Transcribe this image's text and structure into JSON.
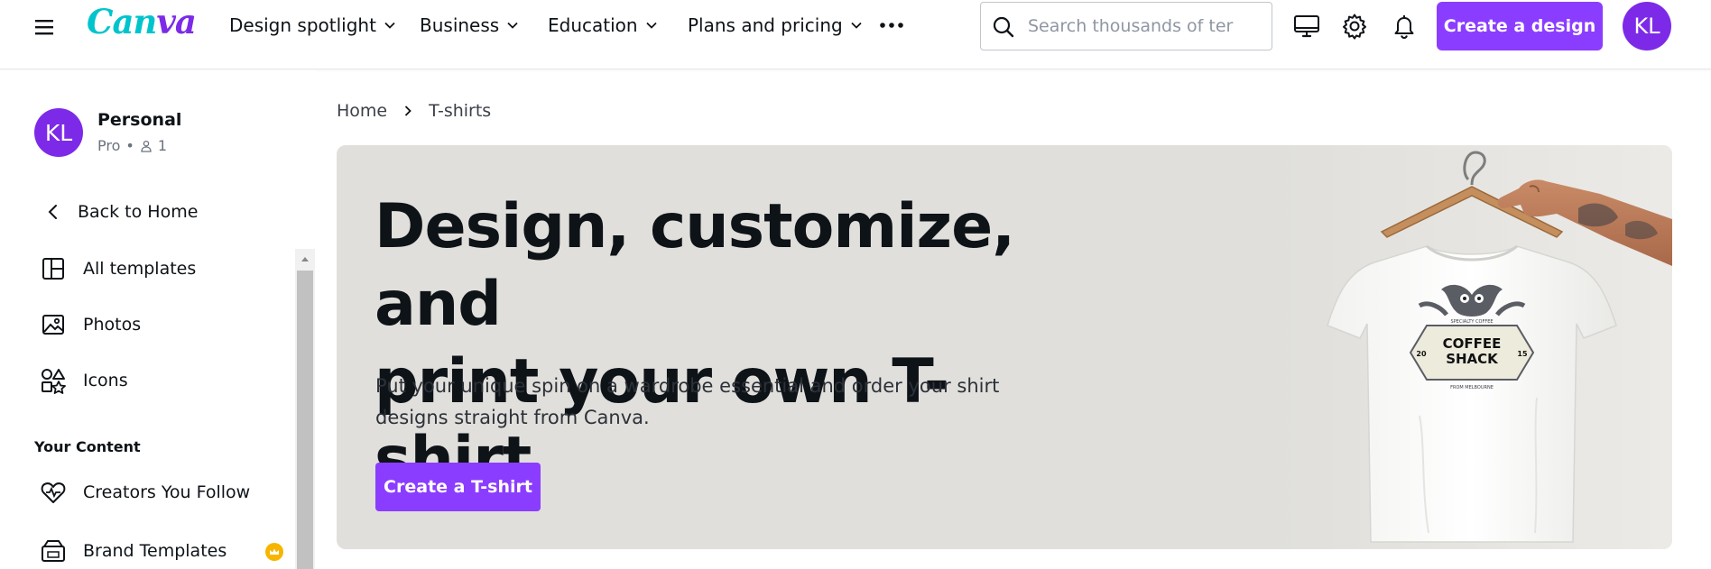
{
  "brand": {
    "logo_text_a": "Can",
    "logo_text_b": "va"
  },
  "nav": {
    "items": [
      {
        "label": "Design spotlight"
      },
      {
        "label": "Business"
      },
      {
        "label": "Education"
      },
      {
        "label": "Plans and pricing"
      }
    ],
    "more_icon": "more-dots-icon"
  },
  "search": {
    "placeholder": "Search thousands of ter",
    "value": ""
  },
  "toolbar": {
    "create_label": "Create a design",
    "avatar_initials": "KL",
    "icons": [
      "desktop-icon",
      "settings-gear-icon",
      "notification-bell-icon"
    ]
  },
  "sidebar": {
    "account_name": "Personal",
    "account_plan": "Pro",
    "account_separator": "•",
    "member_count": "1",
    "avatar_initials": "KL",
    "items": [
      {
        "label": "Back to Home",
        "icon": "chevron-left-icon"
      },
      {
        "label": "All templates",
        "icon": "templates-icon"
      },
      {
        "label": "Photos",
        "icon": "photo-icon"
      },
      {
        "label": "Icons",
        "icon": "shapes-icon"
      }
    ],
    "section_label": "Your Content",
    "content_items": [
      {
        "label": "Creators You Follow",
        "icon": "heart-icon"
      },
      {
        "label": "Brand Templates",
        "icon": "brand-kit-icon"
      }
    ]
  },
  "breadcrumb": {
    "home": "Home",
    "current": "T-shirts"
  },
  "hero": {
    "title_line1": "Design, customize, and",
    "title_line2": "print your own T-shirt",
    "subtitle_line1": "Put your unique spin on a wardrobe essential and order your shirt",
    "subtitle_line2": "designs straight from Canva.",
    "cta_label": "Create a T-shirt",
    "shirt_print": {
      "top_arc": "SPECIALTY COFFEE",
      "line1": "COFFEE",
      "line2": "SHACK",
      "year_left": "20",
      "year_right": "15",
      "bottom_arc": "FROM MELBOURNE"
    }
  },
  "colors": {
    "accent": "#8b3dff",
    "logo_cyan": "#00c4cc",
    "logo_purple": "#7d2ae8",
    "hero_bg": "#e0dfdb",
    "badge": "#f7b500"
  }
}
